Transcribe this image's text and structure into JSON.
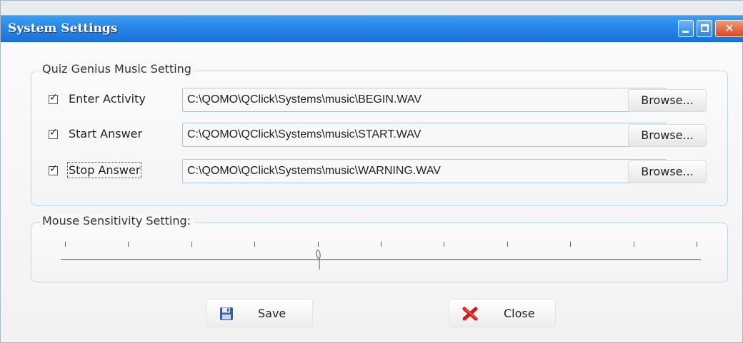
{
  "window": {
    "title": "System Settings",
    "title_bar_color": "#2a86e6"
  },
  "titlebar_buttons": {
    "minimize_icon": "minimize-icon",
    "maximize_icon": "maximize-icon",
    "close_icon": "close-icon"
  },
  "music": {
    "group_label": "Quiz Genius Music Setting",
    "rows": [
      {
        "label": "Enter Activity",
        "checked": true,
        "path": "C:\\QOMO\\QClick\\Systems\\music\\BEGIN.WAV",
        "browse_label": "Browse..."
      },
      {
        "label": "Start Answer",
        "checked": true,
        "path": "C:\\QOMO\\QClick\\Systems\\music\\START.WAV",
        "browse_label": "Browse..."
      },
      {
        "label": "Stop Answer",
        "checked": true,
        "path": "C:\\QOMO\\QClick\\Systems\\music\\WARNING.WAV",
        "browse_label": "Browse..."
      }
    ]
  },
  "mouse": {
    "group_label": "Mouse Sensitivity Setting:",
    "slider": {
      "min": 0,
      "max": 10,
      "value": 4,
      "tick_count": 11
    }
  },
  "footer": {
    "save_label": "Save",
    "close_label": "Close",
    "save_icon": "floppy-disk-icon",
    "close_icon": "red-x-icon"
  }
}
